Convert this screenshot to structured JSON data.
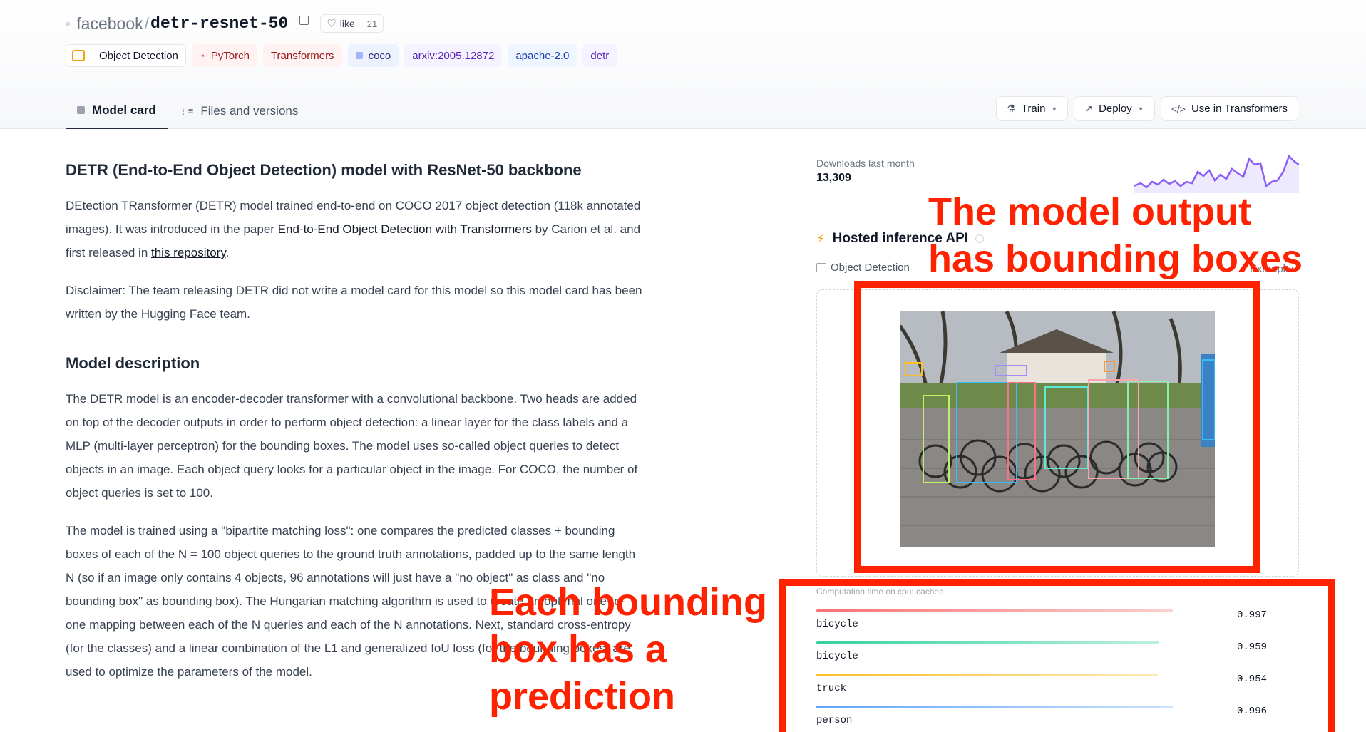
{
  "repo": {
    "org": "facebook",
    "separator": "/",
    "name": "detr-resnet-50",
    "like_label": "like",
    "like_count": "21"
  },
  "tags": [
    "Object Detection",
    "PyTorch",
    "Transformers",
    "coco",
    "arxiv:2005.12872",
    "apache-2.0",
    "detr"
  ],
  "tabs": [
    {
      "label": "Model card",
      "active": true
    },
    {
      "label": "Files and versions",
      "active": false
    }
  ],
  "actions": [
    "Train",
    "Deploy",
    "Use in Transformers"
  ],
  "content": {
    "title": "DETR (End-to-End Object Detection) model with ResNet-50 backbone",
    "p1_a": "DEtection TRansformer (DETR) model trained end-to-end on COCO 2017 object detection (118k annotated images). It was introduced in the paper ",
    "p1_link1": "End-to-End Object Detection with Transformers",
    "p1_b": " by Carion et al. and first released in ",
    "p1_link2": "this repository",
    "p1_c": ".",
    "p2": "Disclaimer: The team releasing DETR did not write a model card for this model so this model card has been written by the Hugging Face team.",
    "h2": "Model description",
    "p3": "The DETR model is an encoder-decoder transformer with a convolutional backbone. Two heads are added on top of the decoder outputs in order to perform object detection: a linear layer for the class labels and a MLP (multi-layer perceptron) for the bounding boxes. The model uses so-called object queries to detect objects in an image. Each object query looks for a particular object in the image. For COCO, the number of object queries is set to 100.",
    "p4": "The model is trained using a \"bipartite matching loss\": one compares the predicted classes + bounding boxes of each of the N = 100 object queries to the ground truth annotations, padded up to the same length N (so if an image only contains 4 objects, 96 annotations will just have a \"no object\" as class and \"no bounding box\" as bounding box). The Hungarian matching algorithm is used to create an optimal one-to-one mapping between each of the N queries and each of the N annotations. Next, standard cross-entropy (for the classes) and a linear combination of the L1 and generalized IoU loss (for the bounding boxes) are used to optimize the parameters of the model."
  },
  "sidebar": {
    "downloads_label": "Downloads last month",
    "downloads_value": "13,309",
    "api_title": "Hosted inference API",
    "task_label": "Object Detection",
    "examples_label": "Examples",
    "computation": "Computation time on cpu: cached",
    "predictions": [
      {
        "label": "bicycle",
        "score": "0.997",
        "fraction": 0.997,
        "color": "#f87171"
      },
      {
        "label": "bicycle",
        "score": "0.959",
        "fraction": 0.959,
        "color": "#34d399"
      },
      {
        "label": "truck",
        "score": "0.954",
        "fraction": 0.954,
        "color": "#fbbf24"
      },
      {
        "label": "person",
        "score": "0.996",
        "fraction": 0.996,
        "color": "#60a5fa"
      }
    ]
  },
  "annotations": {
    "top_line1": "The model output",
    "top_line2": "has bounding boxes",
    "bottom_line1": "Each bounding",
    "bottom_line2": "box has a",
    "bottom_line3": "prediction"
  },
  "colors": {
    "annotation": "#ff2200",
    "accent": "#f59e0b"
  }
}
